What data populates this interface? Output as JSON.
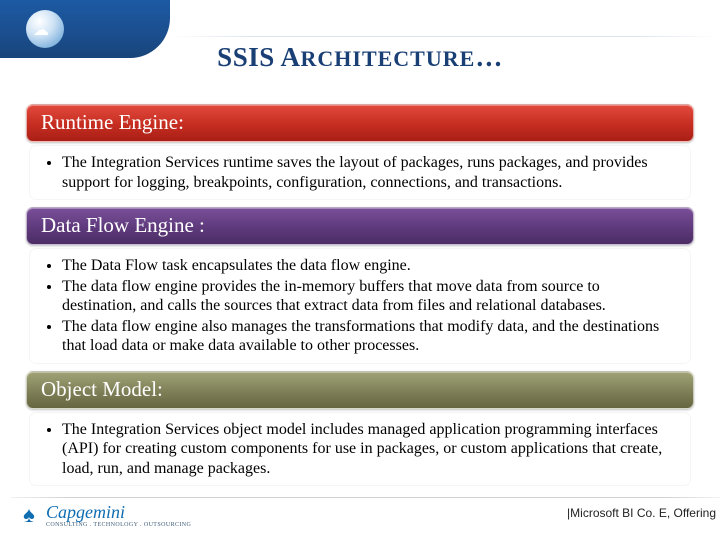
{
  "title_main": "SSIS A",
  "title_caps": "RCHITECTURE",
  "title_suffix": "…",
  "sections": [
    {
      "heading": "Runtime Engine:",
      "bullets": [
        "The Integration Services runtime saves the layout of packages, runs packages, and provides support for logging, breakpoints, configuration, connections, and transactions."
      ]
    },
    {
      "heading": "Data Flow Engine :",
      "bullets": [
        "The Data Flow task encapsulates the data flow engine.",
        "The data flow engine provides the in-memory buffers that move data from source to destination, and calls the sources that extract data from files and relational databases.",
        "The data flow engine also manages the transformations that modify data, and the destinations that load data or make data available to other processes."
      ]
    },
    {
      "heading": "Object Model:",
      "bullets": [
        "The Integration Services object model includes managed application programming interfaces (API) for creating custom components for use in packages, or custom applications that create, load, run, and manage packages."
      ]
    }
  ],
  "footer": {
    "brand": "Capgemini",
    "tagline": "CONSULTING . TECHNOLOGY . OUTSOURCING",
    "right": "|Microsoft BI Co. E, Offering"
  }
}
